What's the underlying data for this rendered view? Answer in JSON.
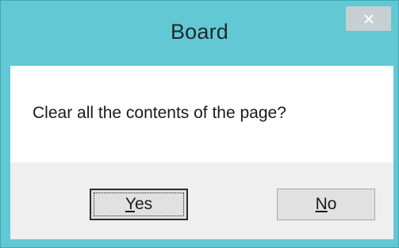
{
  "dialog": {
    "title": "Board",
    "message": "Clear all the contents of the page?",
    "close_icon": "close-icon"
  },
  "buttons": {
    "yes": {
      "accel": "Y",
      "rest": "es"
    },
    "no": {
      "accel": "N",
      "rest": "o"
    }
  },
  "colors": {
    "frame": "#62c8d3",
    "close_button": "#c8cfd2",
    "button_area": "#efefef",
    "button_face": "#e1e1e1"
  }
}
